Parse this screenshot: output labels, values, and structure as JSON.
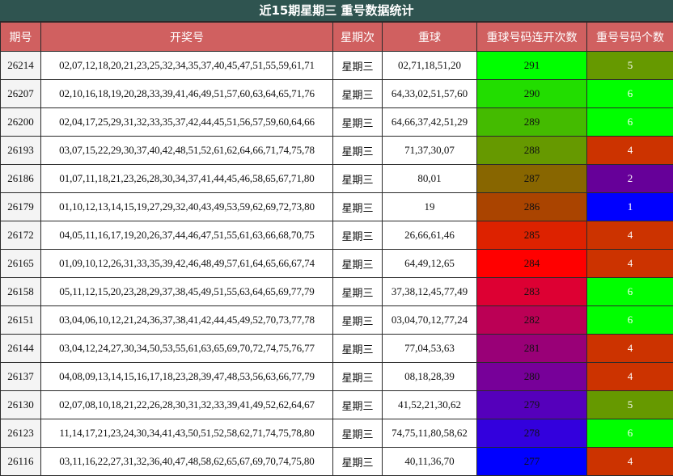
{
  "title": "近15期星期三 重号数据统计",
  "headers": [
    "期号",
    "开奖号",
    "星期次",
    "重球",
    "重球号码连开次数",
    "重号号码个数"
  ],
  "rows": [
    {
      "issue": "26214",
      "numbers": "02,07,12,18,20,21,23,25,32,34,35,37,40,45,47,51,55,59,61,71",
      "weekday": "星期三",
      "repeat": "02,71,18,51,20",
      "seq": "291",
      "count": "5",
      "seq_color": "#00ff00",
      "count_color": "#669900"
    },
    {
      "issue": "26207",
      "numbers": "02,10,16,18,19,20,28,33,39,41,46,49,51,57,60,63,64,65,71,76",
      "weekday": "星期三",
      "repeat": "64,33,02,51,57,60",
      "seq": "290",
      "count": "6",
      "seq_color": "#22dd00",
      "count_color": "#00ff00"
    },
    {
      "issue": "26200",
      "numbers": "02,04,17,25,29,31,32,33,35,37,42,44,45,51,56,57,59,60,64,66",
      "weekday": "星期三",
      "repeat": "64,66,37,42,51,29",
      "seq": "289",
      "count": "6",
      "seq_color": "#44bb00",
      "count_color": "#00ff00"
    },
    {
      "issue": "26193",
      "numbers": "03,07,15,22,29,30,37,40,42,48,51,52,61,62,64,66,71,74,75,78",
      "weekday": "星期三",
      "repeat": "71,37,30,07",
      "seq": "288",
      "count": "4",
      "seq_color": "#669900",
      "count_color": "#cc3300"
    },
    {
      "issue": "26186",
      "numbers": "01,07,11,18,21,23,26,28,30,34,37,41,44,45,46,58,65,67,71,80",
      "weekday": "星期三",
      "repeat": "80,01",
      "seq": "287",
      "count": "2",
      "seq_color": "#886600",
      "count_color": "#660099"
    },
    {
      "issue": "26179",
      "numbers": "01,10,12,13,14,15,19,27,29,32,40,43,49,53,59,62,69,72,73,80",
      "weekday": "星期三",
      "repeat": "19",
      "seq": "286",
      "count": "1",
      "seq_color": "#aa4400",
      "count_color": "#0000ff"
    },
    {
      "issue": "26172",
      "numbers": "04,05,11,16,17,19,20,26,37,44,46,47,51,55,61,63,66,68,70,75",
      "weekday": "星期三",
      "repeat": "26,66,61,46",
      "seq": "285",
      "count": "4",
      "seq_color": "#dd2200",
      "count_color": "#cc3300"
    },
    {
      "issue": "26165",
      "numbers": "01,09,10,12,26,31,33,35,39,42,46,48,49,57,61,64,65,66,67,74",
      "weekday": "星期三",
      "repeat": "64,49,12,65",
      "seq": "284",
      "count": "4",
      "seq_color": "#ff0000",
      "count_color": "#cc3300"
    },
    {
      "issue": "26158",
      "numbers": "05,11,12,15,20,23,28,29,37,38,45,49,51,55,63,64,65,69,77,79",
      "weekday": "星期三",
      "repeat": "37,38,12,45,77,49",
      "seq": "283",
      "count": "6",
      "seq_color": "#dd0033",
      "count_color": "#00ff00"
    },
    {
      "issue": "26151",
      "numbers": "03,04,06,10,12,21,24,36,37,38,41,42,44,45,49,52,70,73,77,78",
      "weekday": "星期三",
      "repeat": "03,04,70,12,77,24",
      "seq": "282",
      "count": "6",
      "seq_color": "#bb0055",
      "count_color": "#00ff00"
    },
    {
      "issue": "26144",
      "numbers": "03,04,12,24,27,30,34,50,53,55,61,63,65,69,70,72,74,75,76,77",
      "weekday": "星期三",
      "repeat": "77,04,53,63",
      "seq": "281",
      "count": "4",
      "seq_color": "#990077",
      "count_color": "#cc3300"
    },
    {
      "issue": "26137",
      "numbers": "04,08,09,13,14,15,16,17,18,23,28,39,47,48,53,56,63,66,77,79",
      "weekday": "星期三",
      "repeat": "08,18,28,39",
      "seq": "280",
      "count": "4",
      "seq_color": "#770099",
      "count_color": "#cc3300"
    },
    {
      "issue": "26130",
      "numbers": "02,07,08,10,18,21,22,26,28,30,31,32,33,39,41,49,52,62,64,67",
      "weekday": "星期三",
      "repeat": "41,52,21,30,62",
      "seq": "279",
      "count": "5",
      "seq_color": "#5500bb",
      "count_color": "#669900"
    },
    {
      "issue": "26123",
      "numbers": "11,14,17,21,23,24,30,34,41,43,50,51,52,58,62,71,74,75,78,80",
      "weekday": "星期三",
      "repeat": "74,75,11,80,58,62",
      "seq": "278",
      "count": "6",
      "seq_color": "#3300dd",
      "count_color": "#00ff00"
    },
    {
      "issue": "26116",
      "numbers": "03,11,16,22,27,31,32,36,40,47,48,58,62,65,67,69,70,74,75,80",
      "weekday": "星期三",
      "repeat": "40,11,36,70",
      "seq": "277",
      "count": "4",
      "seq_color": "#0000ff",
      "count_color": "#cc3300"
    }
  ]
}
